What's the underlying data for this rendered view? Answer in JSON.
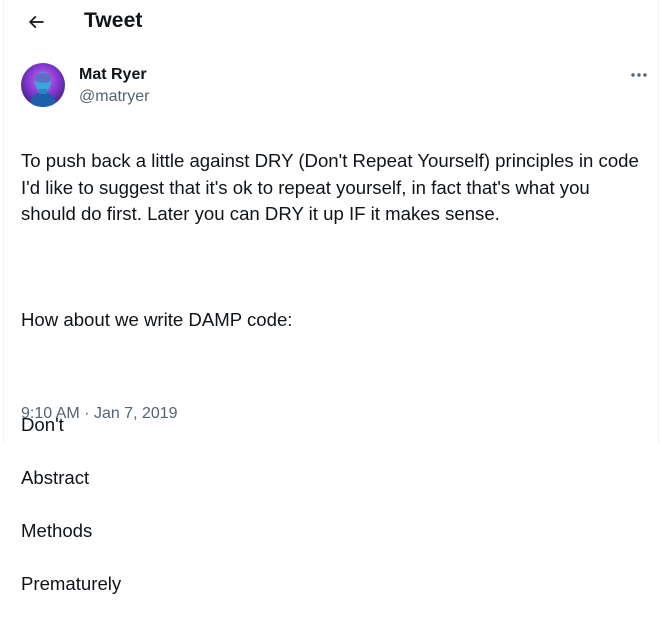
{
  "header": {
    "title": "Tweet",
    "back_icon": "arrow-left-icon"
  },
  "author": {
    "name": "Mat Ryer",
    "handle": "@matryer",
    "avatar_icon": "avatar-icon"
  },
  "more_icon": "more-horizontal-icon",
  "tweet": {
    "paragraph1": "To push back a little against DRY (Don't Repeat Yourself) principles in code I'd like to suggest that it's ok to repeat yourself, in fact that's what you should do first. Later you can DRY it up IF it makes sense.",
    "paragraph2": "How about we write DAMP code:",
    "lines": [
      "Don't",
      "Abstract",
      "Methods",
      "Prematurely"
    ]
  },
  "meta": {
    "time": "9:10 AM",
    "separator": "·",
    "date": "Jan 7, 2019"
  },
  "colors": {
    "text": "#0f1419",
    "secondary": "#536471",
    "border": "#eff3f4"
  }
}
